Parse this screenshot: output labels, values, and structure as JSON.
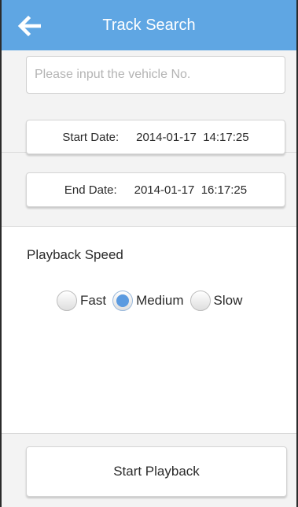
{
  "header": {
    "title": "Track Search",
    "back_icon": "back-arrow-icon",
    "background": "#5fa6e3"
  },
  "search": {
    "placeholder": "Please input the vehicle No.",
    "value": ""
  },
  "dates": {
    "start_label": "Start Date:",
    "start_value": "2014-01-17  14:17:25",
    "end_label": "End Date:",
    "end_value": "2014-01-17  16:17:25"
  },
  "playback": {
    "label": "Playback Speed",
    "options": [
      "Fast",
      "Medium",
      "Slow"
    ],
    "selected": "Medium"
  },
  "actions": {
    "start_label": "Start Playback"
  }
}
